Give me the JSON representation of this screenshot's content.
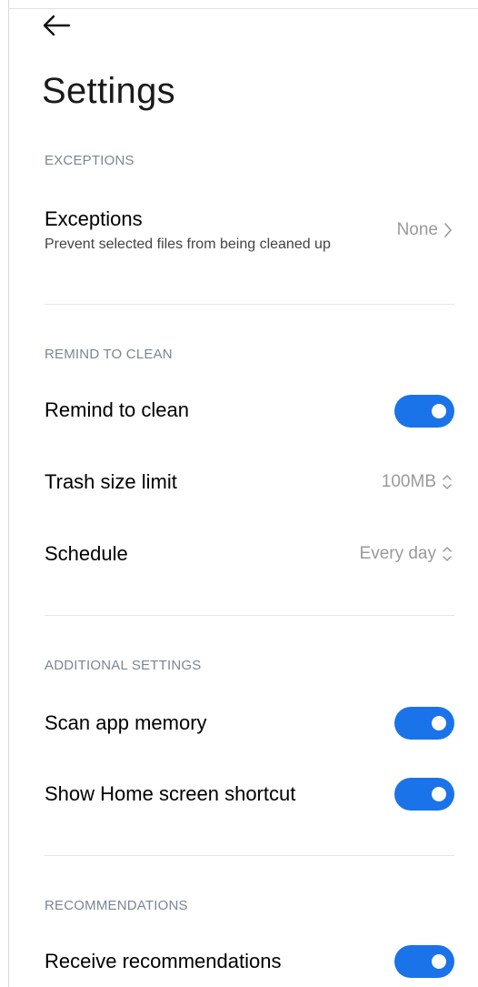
{
  "header": {
    "back_icon": "arrow-left-icon",
    "title": "Settings"
  },
  "colors": {
    "accent": "#1a73e8",
    "section_header": "#7b8595",
    "value_text": "#9a9a9a"
  },
  "sections": {
    "exceptions": {
      "header": "EXCEPTIONS",
      "item": {
        "title": "Exceptions",
        "subtitle": "Prevent selected files from being cleaned up",
        "value": "None",
        "icon": "chevron-right-icon"
      }
    },
    "remind": {
      "header": "REMIND TO CLEAN",
      "remind_to_clean": {
        "title": "Remind to clean",
        "enabled": true
      },
      "trash_size_limit": {
        "title": "Trash size limit",
        "value": "100MB",
        "icon": "updown-chevron-icon"
      },
      "schedule": {
        "title": "Schedule",
        "value": "Every day",
        "icon": "updown-chevron-icon"
      }
    },
    "additional": {
      "header": "ADDITIONAL SETTINGS",
      "scan_app_memory": {
        "title": "Scan app memory",
        "enabled": true
      },
      "home_shortcut": {
        "title": "Show Home screen shortcut",
        "enabled": true
      }
    },
    "recommendations": {
      "header": "RECOMMENDATIONS",
      "receive": {
        "title": "Receive recommendations",
        "enabled": true
      }
    }
  }
}
